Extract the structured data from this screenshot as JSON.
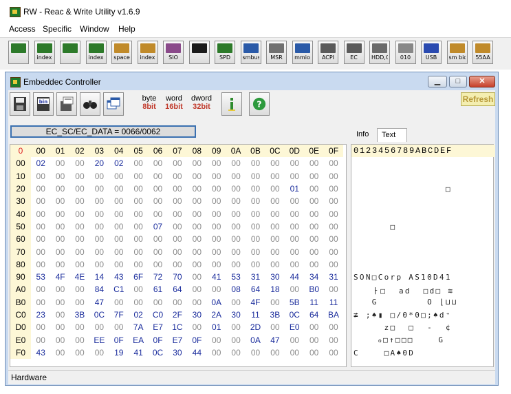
{
  "app": {
    "title": "RW - Reac & Write Utility v1.6.9"
  },
  "menu": [
    "Access",
    "Specific",
    "Window",
    "Help"
  ],
  "toolbar": [
    {
      "icon": "pci-card-icon",
      "label": "",
      "color": "#2d7a2a"
    },
    {
      "icon": "index-card-icon",
      "label": "index",
      "color": "#2d7a2a"
    },
    {
      "icon": "memory-icon",
      "label": "",
      "color": "#2d7a2a"
    },
    {
      "icon": "memory-index-icon",
      "label": "index",
      "color": "#2d7a2a"
    },
    {
      "icon": "io-space-icon",
      "label": "space",
      "color": "#c08a2a"
    },
    {
      "icon": "io-index-icon",
      "label": "index",
      "color": "#c08a2a"
    },
    {
      "icon": "sio-icon",
      "label": "SIO",
      "color": "#8a4a8a"
    },
    {
      "icon": "oscilloscope-icon",
      "label": "",
      "color": "#1a1a1a"
    },
    {
      "icon": "spd-icon",
      "label": "SPD",
      "color": "#2d7a2a"
    },
    {
      "icon": "smbus-icon",
      "label": "smbus",
      "color": "#2a5aa8"
    },
    {
      "icon": "msr-chip-icon",
      "label": "MSR",
      "color": "#707070"
    },
    {
      "icon": "mmio-icon",
      "label": "mmio",
      "color": "#2a5aa8"
    },
    {
      "icon": "acpi-icon",
      "label": "ACPI",
      "color": "#5a5a5a"
    },
    {
      "icon": "ec-laptop-icon",
      "label": "EC",
      "color": "#5a5a5a"
    },
    {
      "icon": "hdd-cd-icon",
      "label": "HDD,CD",
      "color": "#6a6a6a"
    },
    {
      "icon": "binary-disk-icon",
      "label": "010",
      "color": "#888888"
    },
    {
      "icon": "usb-icon",
      "label": "USB",
      "color": "#2a4ab0"
    },
    {
      "icon": "sm-bios-icon",
      "label": "sm bios",
      "color": "#c08a2a"
    },
    {
      "icon": "55aa-icon",
      "label": "55AA",
      "color": "#c08a2a"
    }
  ],
  "window": {
    "title": "Embeddec Controller",
    "refresh_label": "Refresh",
    "size_buttons": [
      {
        "top": "byte",
        "bottom": "8bit",
        "color": "#c0392b"
      },
      {
        "top": "word",
        "bottom": "16bit",
        "color": "#c0392b"
      },
      {
        "top": "dword",
        "bottom": "32bit",
        "color": "#c0392b"
      }
    ],
    "ec_port": "EC_SC/EC_DATA = 0066/0062",
    "tabs": [
      {
        "label": "Info"
      },
      {
        "label": "Text"
      }
    ],
    "status": "Hardware"
  },
  "hex": {
    "corner": "0",
    "col_headers": [
      "00",
      "01",
      "02",
      "03",
      "04",
      "05",
      "06",
      "07",
      "08",
      "09",
      "0A",
      "0B",
      "0C",
      "0D",
      "0E",
      "0F"
    ],
    "rows": [
      {
        "h": "00",
        "c": [
          "02",
          "00",
          "00",
          "20",
          "02",
          "00",
          "00",
          "00",
          "00",
          "00",
          "00",
          "00",
          "00",
          "00",
          "00",
          "00"
        ]
      },
      {
        "h": "10",
        "c": [
          "00",
          "00",
          "00",
          "00",
          "00",
          "00",
          "00",
          "00",
          "00",
          "00",
          "00",
          "00",
          "00",
          "00",
          "00",
          "00"
        ]
      },
      {
        "h": "20",
        "c": [
          "00",
          "00",
          "00",
          "00",
          "00",
          "00",
          "00",
          "00",
          "00",
          "00",
          "00",
          "00",
          "00",
          "01",
          "00",
          "00"
        ]
      },
      {
        "h": "30",
        "c": [
          "00",
          "00",
          "00",
          "00",
          "00",
          "00",
          "00",
          "00",
          "00",
          "00",
          "00",
          "00",
          "00",
          "00",
          "00",
          "00"
        ]
      },
      {
        "h": "40",
        "c": [
          "00",
          "00",
          "00",
          "00",
          "00",
          "00",
          "00",
          "00",
          "00",
          "00",
          "00",
          "00",
          "00",
          "00",
          "00",
          "00"
        ]
      },
      {
        "h": "50",
        "c": [
          "00",
          "00",
          "00",
          "00",
          "00",
          "00",
          "07",
          "00",
          "00",
          "00",
          "00",
          "00",
          "00",
          "00",
          "00",
          "00"
        ]
      },
      {
        "h": "60",
        "c": [
          "00",
          "00",
          "00",
          "00",
          "00",
          "00",
          "00",
          "00",
          "00",
          "00",
          "00",
          "00",
          "00",
          "00",
          "00",
          "00"
        ]
      },
      {
        "h": "70",
        "c": [
          "00",
          "00",
          "00",
          "00",
          "00",
          "00",
          "00",
          "00",
          "00",
          "00",
          "00",
          "00",
          "00",
          "00",
          "00",
          "00"
        ]
      },
      {
        "h": "80",
        "c": [
          "00",
          "00",
          "00",
          "00",
          "00",
          "00",
          "00",
          "00",
          "00",
          "00",
          "00",
          "00",
          "00",
          "00",
          "00",
          "00"
        ]
      },
      {
        "h": "90",
        "c": [
          "53",
          "4F",
          "4E",
          "14",
          "43",
          "6F",
          "72",
          "70",
          "00",
          "41",
          "53",
          "31",
          "30",
          "44",
          "34",
          "31"
        ]
      },
      {
        "h": "A0",
        "c": [
          "00",
          "00",
          "00",
          "84",
          "C1",
          "00",
          "61",
          "64",
          "00",
          "00",
          "08",
          "64",
          "18",
          "00",
          "B0",
          "00"
        ]
      },
      {
        "h": "B0",
        "c": [
          "00",
          "00",
          "00",
          "47",
          "00",
          "00",
          "00",
          "00",
          "00",
          "0A",
          "00",
          "4F",
          "00",
          "5B",
          "11",
          "11"
        ]
      },
      {
        "h": "C0",
        "c": [
          "23",
          "00",
          "3B",
          "0C",
          "7F",
          "02",
          "C0",
          "2F",
          "30",
          "2A",
          "30",
          "11",
          "3B",
          "0C",
          "64",
          "BA"
        ]
      },
      {
        "h": "D0",
        "c": [
          "00",
          "00",
          "00",
          "00",
          "00",
          "7A",
          "E7",
          "1C",
          "00",
          "01",
          "00",
          "2D",
          "00",
          "E0",
          "00",
          "00"
        ]
      },
      {
        "h": "E0",
        "c": [
          "00",
          "00",
          "00",
          "EE",
          "0F",
          "EA",
          "0F",
          "E7",
          "0F",
          "00",
          "00",
          "0A",
          "47",
          "00",
          "00",
          "00"
        ]
      },
      {
        "h": "F0",
        "c": [
          "43",
          "00",
          "00",
          "00",
          "19",
          "41",
          "0C",
          "30",
          "44",
          "00",
          "00",
          "00",
          "00",
          "00",
          "00",
          "00"
        ]
      }
    ]
  },
  "text_view": {
    "header": "0123456789ABCDEF",
    "lines": [
      "",
      "",
      "               □",
      "",
      "",
      "      □",
      "",
      "",
      "",
      "SON□Corp AS10D41",
      "   ㅏ□  ad  □d□ ≋",
      "   G        O ⌊⊔⊔",
      "≢ ;♠▮ □/0*0□;♠d⁺",
      "     z□  □  -  ¢",
      "    ℴ□↑□□□    G",
      "C    □A♠0D"
    ]
  }
}
